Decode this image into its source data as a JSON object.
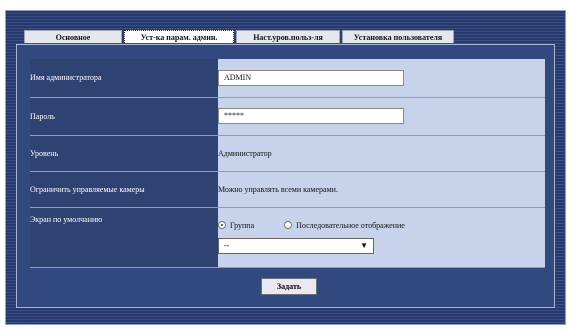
{
  "tabs": [
    {
      "label": "Основное"
    },
    {
      "label": "Уст-ка парам. админ."
    },
    {
      "label": "Наст.уров.польз-ля"
    },
    {
      "label": "Установка пользователя"
    }
  ],
  "form": {
    "admin_name_label": "Имя администратора",
    "admin_name_value": "ADMIN",
    "password_label": "Пароль",
    "password_value": "*****",
    "level_label": "Уровень",
    "level_value": "Администратор",
    "limit_cameras_label": "Ограничить управляемые камеры",
    "limit_cameras_value": "Можно управлять всеми камерами.",
    "default_screen_label": "Экран по умолчанию",
    "radio_group_label": "Группа",
    "radio_sequence_label": "Последовательное отображение",
    "select_value": "--"
  },
  "submit_label": "Задать",
  "colors": {
    "panel": "#31497e",
    "label_cell": "#2e4372",
    "value_cell": "#c7d3ea"
  }
}
